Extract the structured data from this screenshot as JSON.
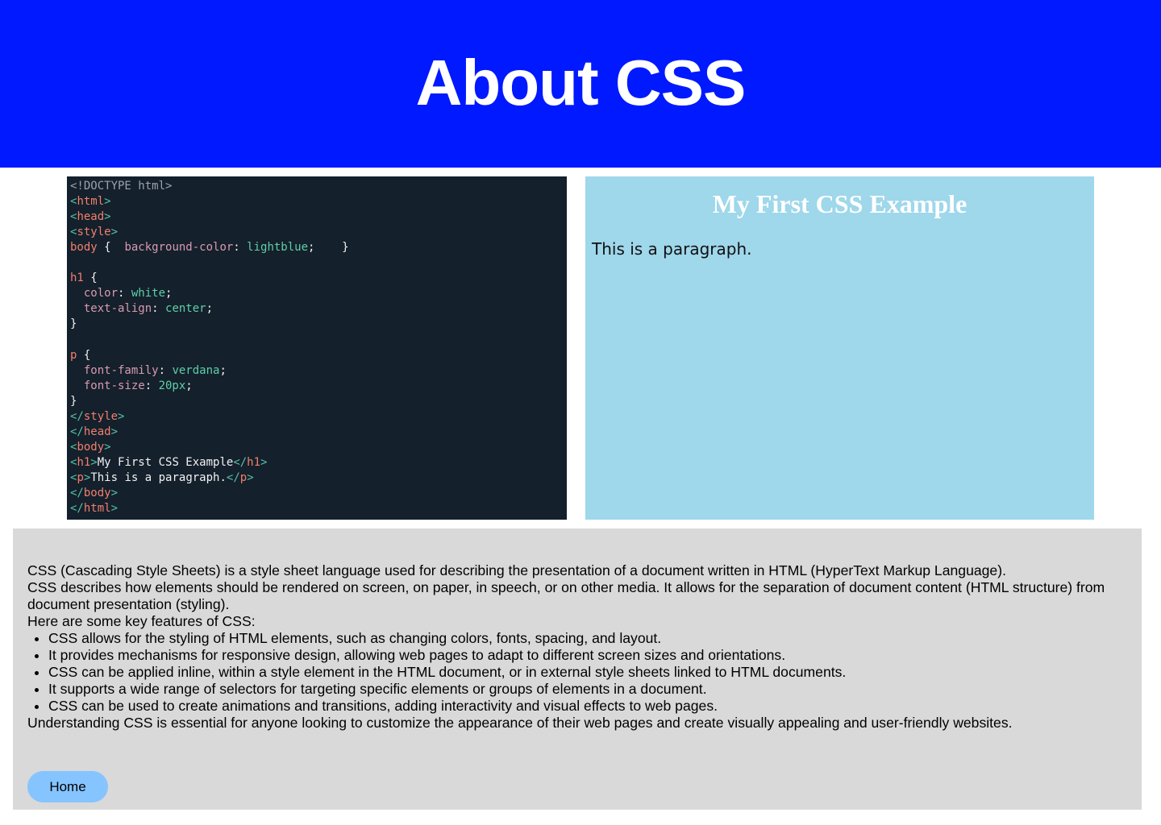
{
  "header": {
    "title": "About CSS"
  },
  "example": {
    "code_lines": [
      [
        {
          "c": "t-doc",
          "t": "<!DOCTYPE html>"
        }
      ],
      [
        {
          "c": "t-br",
          "t": "<"
        },
        {
          "c": "t-tag",
          "t": "html"
        },
        {
          "c": "t-br",
          "t": ">"
        }
      ],
      [
        {
          "c": "t-br",
          "t": "<"
        },
        {
          "c": "t-tag",
          "t": "head"
        },
        {
          "c": "t-br",
          "t": ">"
        }
      ],
      [
        {
          "c": "t-br",
          "t": "<"
        },
        {
          "c": "t-tag",
          "t": "style"
        },
        {
          "c": "t-br",
          "t": ">"
        }
      ],
      [
        {
          "c": "t-sel",
          "t": "body"
        },
        {
          "c": "t-txt",
          "t": " {  "
        },
        {
          "c": "t-prop",
          "t": "background-color"
        },
        {
          "c": "t-txt",
          "t": ": "
        },
        {
          "c": "t-val",
          "t": "lightblue"
        },
        {
          "c": "t-txt",
          "t": ";    }"
        }
      ],
      [
        {
          "c": "t-txt",
          "t": ""
        }
      ],
      [
        {
          "c": "t-sel",
          "t": "h1"
        },
        {
          "c": "t-txt",
          "t": " {"
        }
      ],
      [
        {
          "c": "t-txt",
          "t": "  "
        },
        {
          "c": "t-prop",
          "t": "color"
        },
        {
          "c": "t-txt",
          "t": ": "
        },
        {
          "c": "t-val",
          "t": "white"
        },
        {
          "c": "t-txt",
          "t": ";"
        }
      ],
      [
        {
          "c": "t-txt",
          "t": "  "
        },
        {
          "c": "t-prop",
          "t": "text-align"
        },
        {
          "c": "t-txt",
          "t": ": "
        },
        {
          "c": "t-val",
          "t": "center"
        },
        {
          "c": "t-txt",
          "t": ";"
        }
      ],
      [
        {
          "c": "t-txt",
          "t": "}"
        }
      ],
      [
        {
          "c": "t-txt",
          "t": ""
        }
      ],
      [
        {
          "c": "t-sel",
          "t": "p"
        },
        {
          "c": "t-txt",
          "t": " {"
        }
      ],
      [
        {
          "c": "t-txt",
          "t": "  "
        },
        {
          "c": "t-prop",
          "t": "font-family"
        },
        {
          "c": "t-txt",
          "t": ": "
        },
        {
          "c": "t-val",
          "t": "verdana"
        },
        {
          "c": "t-txt",
          "t": ";"
        }
      ],
      [
        {
          "c": "t-txt",
          "t": "  "
        },
        {
          "c": "t-prop",
          "t": "font-size"
        },
        {
          "c": "t-txt",
          "t": ": "
        },
        {
          "c": "t-val",
          "t": "20px"
        },
        {
          "c": "t-txt",
          "t": ";"
        }
      ],
      [
        {
          "c": "t-txt",
          "t": "}"
        }
      ],
      [
        {
          "c": "t-br",
          "t": "</"
        },
        {
          "c": "t-tag",
          "t": "style"
        },
        {
          "c": "t-br",
          "t": ">"
        }
      ],
      [
        {
          "c": "t-br",
          "t": "</"
        },
        {
          "c": "t-tag",
          "t": "head"
        },
        {
          "c": "t-br",
          "t": ">"
        }
      ],
      [
        {
          "c": "t-br",
          "t": "<"
        },
        {
          "c": "t-tag",
          "t": "body"
        },
        {
          "c": "t-br",
          "t": ">"
        }
      ],
      [
        {
          "c": "t-br",
          "t": "<"
        },
        {
          "c": "t-tag",
          "t": "h1"
        },
        {
          "c": "t-br",
          "t": ">"
        },
        {
          "c": "t-txt",
          "t": "My First CSS Example"
        },
        {
          "c": "t-br",
          "t": "</"
        },
        {
          "c": "t-tag",
          "t": "h1"
        },
        {
          "c": "t-br",
          "t": ">"
        }
      ],
      [
        {
          "c": "t-br",
          "t": "<"
        },
        {
          "c": "t-tag",
          "t": "p"
        },
        {
          "c": "t-br",
          "t": ">"
        },
        {
          "c": "t-txt",
          "t": "This is a paragraph."
        },
        {
          "c": "t-br",
          "t": "</"
        },
        {
          "c": "t-tag",
          "t": "p"
        },
        {
          "c": "t-br",
          "t": ">"
        }
      ],
      [
        {
          "c": "t-br",
          "t": "</"
        },
        {
          "c": "t-tag",
          "t": "body"
        },
        {
          "c": "t-br",
          "t": ">"
        }
      ],
      [
        {
          "c": "t-br",
          "t": "</"
        },
        {
          "c": "t-tag",
          "t": "html"
        },
        {
          "c": "t-br",
          "t": ">"
        }
      ]
    ],
    "preview_heading": "My First CSS Example",
    "preview_paragraph": "This is a paragraph.",
    "colors": {
      "editor_bg": "#14202b",
      "preview_bg": "#9fd7eb"
    }
  },
  "description": {
    "intro_lines": [
      "CSS (Cascading Style Sheets) is a style sheet language used for describing the presentation of a document written in HTML (HyperText Markup Language).",
      "CSS describes how elements should be rendered on screen, on paper, in speech, or on other media. It allows for the separation of document content (HTML structure) from document presentation (styling).",
      "Here are some key features of CSS:"
    ],
    "features": [
      "CSS allows for the styling of HTML elements, such as changing colors, fonts, spacing, and layout.",
      "It provides mechanisms for responsive design, allowing web pages to adapt to different screen sizes and orientations.",
      "CSS can be applied inline, within a style element in the HTML document, or in external style sheets linked to HTML documents.",
      "It supports a wide range of selectors for targeting specific elements or groups of elements in a document.",
      "CSS can be used to create animations and transitions, adding interactivity and visual effects to web pages."
    ],
    "closing": "Understanding CSS is essential for anyone looking to customize the appearance of their web pages and create visually appealing and user-friendly websites."
  },
  "nav": {
    "home_label": "Home"
  },
  "theme": {
    "header_bg": "#0019ff",
    "panel_bg": "#d9d9d9",
    "button_bg": "#85c4ff"
  }
}
